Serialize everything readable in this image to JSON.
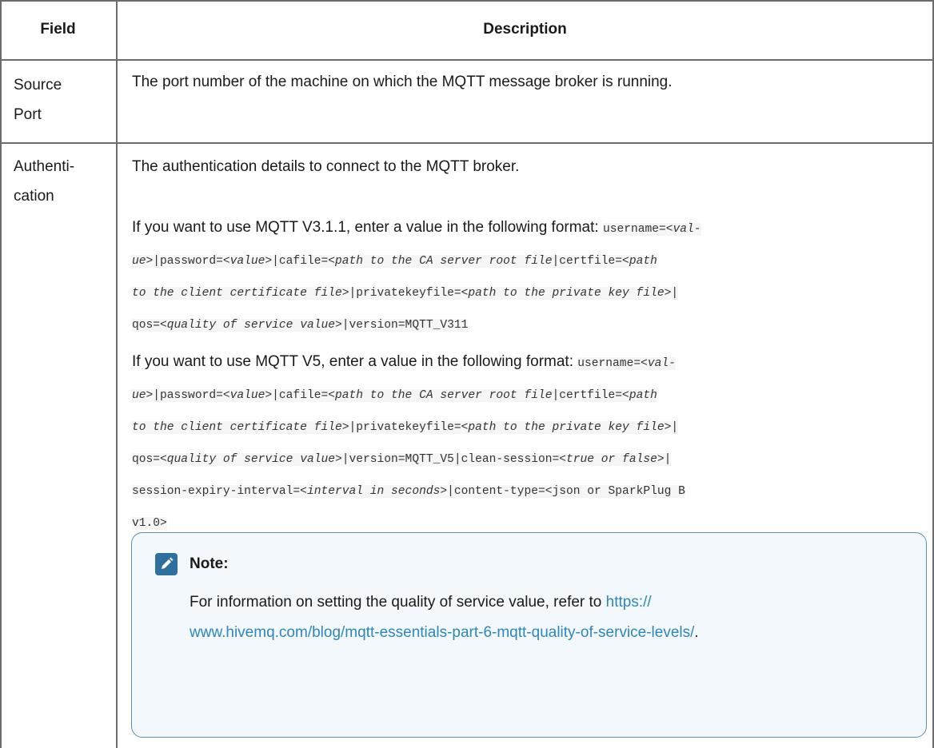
{
  "table": {
    "headers": [
      "Field",
      "Description"
    ],
    "rows": [
      {
        "field_line1": "Source",
        "field_line2": "Port",
        "description": "The port number of the machine on which the MQTT message broker is running."
      },
      {
        "field_line1": "Authenti-",
        "field_line2": "cation",
        "description": "The authentication details to connect to the MQTT broker.",
        "v311_intro": "If you want to use MQTT V3.1.1, enter a value in the following format:",
        "v5_intro": "If you want to use MQTT V5, enter a value in the following format:",
        "note_title": "Note:",
        "note_text": "For information on setting the quality of service value, refer to",
        "note_link_line1": "https://",
        "note_link_line2": "www.hivemq.com/blog/mqtt-essentials-part-6-mqtt-quality-of-service-levels/",
        "note_link_end": "."
      }
    ]
  },
  "icons": {
    "note": "pencil-note-icon"
  },
  "colors": {
    "link": "#2f86b8",
    "note_border": "#5b8fb4",
    "note_icon": "#2e6f9e"
  }
}
